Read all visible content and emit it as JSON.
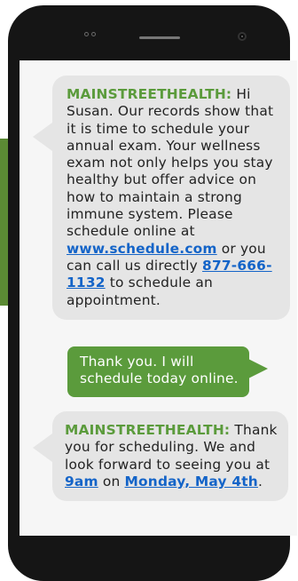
{
  "message1": {
    "sender": "MAINSTREETHEALTH:",
    "greeting": " Hi Susan.",
    "body_part1": " Our records show that it is time to schedule your annual exam. Your wellness exam not only helps you stay healthy but offer advice on how to maintain a strong immune system. Please schedule online at ",
    "link_url": "www.schedule.com",
    "body_part2": " or you can call us directly ",
    "phone": "877-666-1132",
    "body_part3": " to schedule an appointment."
  },
  "reply": {
    "text": "Thank you. I will schedule today online."
  },
  "message2": {
    "sender": "MAINSTREETHEALTH:",
    "body_part1": " Thank you for scheduling. We and look forward to seeing you at ",
    "time_link": "9am",
    "body_part2": " on ",
    "date_link": "Monday, May 4th",
    "body_part3": "."
  },
  "colors": {
    "brand_green": "#5b9b3c",
    "link_blue": "#1464c8",
    "incoming_bubble": "#e5e5e5",
    "phone_body": "#151515"
  },
  "icons": [
    "camera-dot-icon",
    "speaker-icon",
    "front-camera-icon"
  ]
}
